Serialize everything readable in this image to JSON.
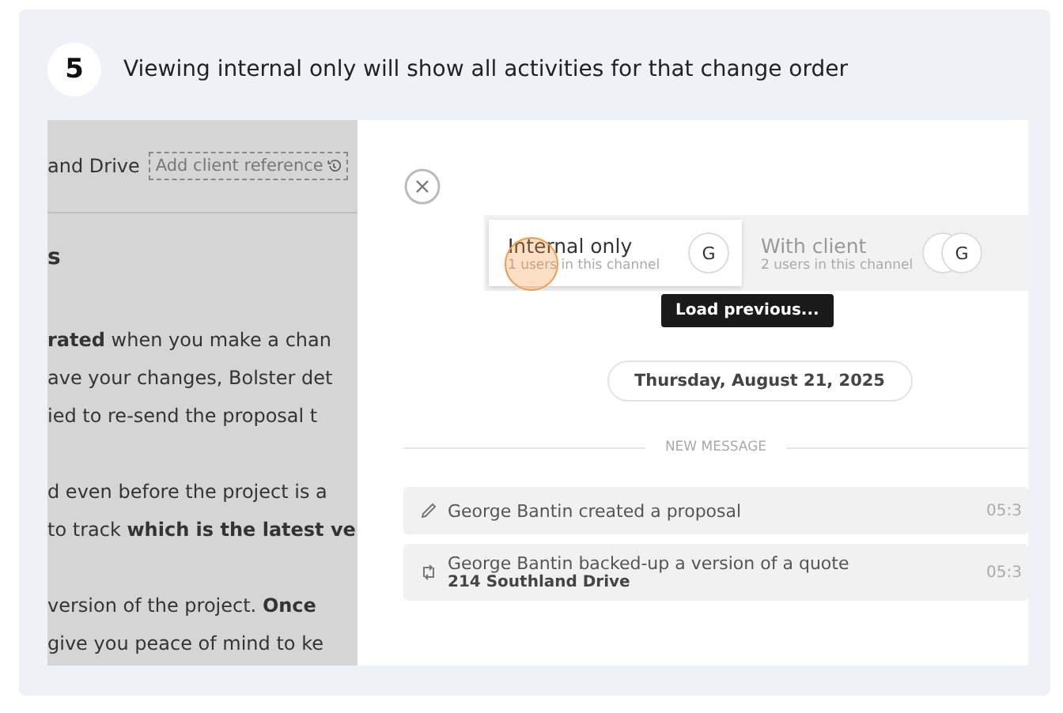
{
  "step": {
    "number": "5",
    "text": "Viewing internal only will show all activities for that change order"
  },
  "background_page": {
    "project": "and Drive",
    "reference_placeholder": "Add client reference",
    "heading": "s",
    "paragraphs": [
      [
        "**rated** when you make a chan",
        "ave your changes, Bolster det",
        "ied to re-send the proposal t"
      ],
      [
        "d even before the project is a",
        "to track **which is the latest ve**"
      ],
      [
        "version of the project. **Once**",
        "give you peace of mind to ke"
      ]
    ]
  },
  "channels": [
    {
      "name": "Internal only",
      "users": "1 users in this channel",
      "avatars": [
        {
          "kind": "letter",
          "letter": "G"
        }
      ],
      "selected": true
    },
    {
      "name": "With client",
      "users": "2 users in this channel",
      "avatars": [
        {
          "kind": "partial"
        },
        {
          "kind": "letter",
          "letter": "G"
        }
      ],
      "selected": false
    }
  ],
  "tooltip": "Load previous...",
  "date": "Thursday, August 21, 2025",
  "divider": "NEW MESSAGE",
  "activities": [
    {
      "kind": "edit",
      "text": "George Bantin created a proposal",
      "time": "05:3"
    },
    {
      "kind": "backup",
      "text": "George Bantin backed-up a version of a quote",
      "detail": "214 Southland Drive",
      "time": "05:3"
    }
  ]
}
